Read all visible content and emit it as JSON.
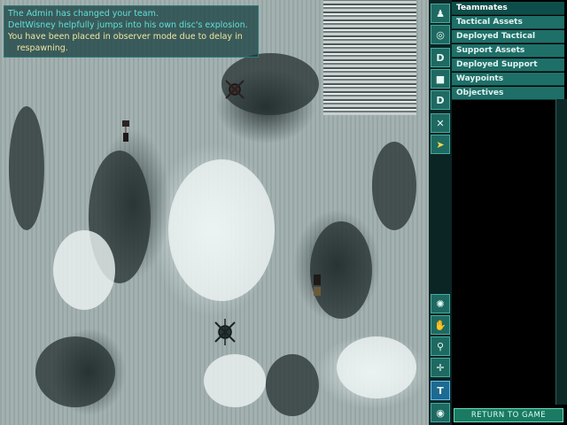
{
  "chat": {
    "lines": [
      {
        "text": "The Admin has changed your team.",
        "color": "#5fe0d8"
      },
      {
        "text": "DeltWisney helpfully jumps into his own disc's explosion.",
        "color": "#5fe0d8"
      },
      {
        "text": "You have been placed in observer mode due to delay in",
        "color": "#f0e6a0"
      },
      {
        "text": "respawning.",
        "color": "#f0e6a0"
      }
    ]
  },
  "command_menu": {
    "items": [
      {
        "label": "Teammates",
        "selected": true
      },
      {
        "label": "Tactical Assets",
        "selected": false
      },
      {
        "label": "Deployed Tactical",
        "selected": false
      },
      {
        "label": "Support Assets",
        "selected": false
      },
      {
        "label": "Deployed Support",
        "selected": false
      },
      {
        "label": "Waypoints",
        "selected": false
      },
      {
        "label": "Objectives",
        "selected": false
      }
    ]
  },
  "top_tools": [
    {
      "icon": "player-icon",
      "glyph": "♟"
    },
    {
      "icon": "target-icon",
      "glyph": "◎"
    },
    {
      "icon": "deploy-icon",
      "glyph": "D"
    },
    {
      "icon": "cube-icon",
      "glyph": "■"
    },
    {
      "icon": "deploy-icon",
      "glyph": "D"
    },
    {
      "icon": "waypoint-icon",
      "glyph": "✕"
    },
    {
      "icon": "cursor-icon",
      "glyph": "➤"
    }
  ],
  "bottom_tools": [
    {
      "icon": "compass-icon",
      "glyph": "✺"
    },
    {
      "icon": "hand-icon",
      "glyph": "✋"
    },
    {
      "icon": "zoom-icon",
      "glyph": "⚲"
    },
    {
      "icon": "center-icon",
      "glyph": "✛"
    },
    {
      "icon": "text-icon",
      "glyph": "T"
    },
    {
      "icon": "camera-icon",
      "glyph": "◉"
    }
  ],
  "return_button": {
    "label": "RETURN TO GAME"
  }
}
